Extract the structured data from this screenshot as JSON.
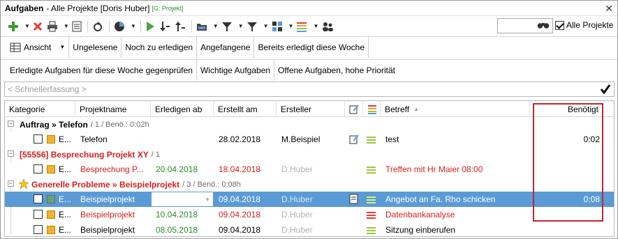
{
  "window": {
    "title": "Aufgaben",
    "subtitle": "- Alle Projekte [Doris Huber]",
    "tag": "[G: Projekt]",
    "close_glyph": "✕"
  },
  "toolbar": {
    "icons": [
      "add-icon",
      "delete-icon",
      "print-icon",
      "report-icon",
      "refresh-icon",
      "chart-icon",
      "play-icon",
      "sort-down-icon",
      "sort-up-icon",
      "folder-icon",
      "filter-icon",
      "filter2-icon",
      "categories-icon",
      "priority-icon",
      "users-icon"
    ],
    "all_projects_label": "Alle Projekte",
    "all_projects_checked": true,
    "search_icon": "binoculars-icon"
  },
  "filters_row1": [
    "Ansicht",
    "Ungelesene",
    "Noch zu erledigen",
    "Angefangene",
    "Bereits erledigt diese Woche"
  ],
  "filters_row2": [
    "Erledigte Aufgaben für diese Woche gegenprüfen",
    "Wichtige Aufgaben",
    "Offene Aufgaben, hohe Priorität"
  ],
  "quick_entry": {
    "placeholder": "< Schnellerfassung >"
  },
  "columns": {
    "kategorie": "Kategorie",
    "projektname": "Projektname",
    "erledigen_ab": "Erledigen ab",
    "erstellt_am": "Erstellt am",
    "ersteller": "Ersteller",
    "betreff": "Betreff",
    "benoetigt": "Benötigt"
  },
  "groups": [
    {
      "title": "Auftrag » Telefon",
      "meta": "/ 1 / Benö.: 0:02h",
      "color": "#1a1a8c",
      "rows": [
        {
          "kat": "E...",
          "projekt": "Telefon",
          "erledigen": "",
          "erstellt": "28.02.2018",
          "ersteller": "M.Beispiel",
          "betreff": "test",
          "benoetigt": "0:02"
        }
      ]
    },
    {
      "title": "[55556] Besprechung Projekt XY",
      "meta": "/ 1",
      "color": "#d42020",
      "rows": [
        {
          "kat": "E...",
          "projekt": "Besprechung P...",
          "erledigen": "20.04.2018",
          "erstellt": "18.04.2018",
          "ersteller": "D.Huber",
          "betreff": "Treffen mit Hr Maier 08:00",
          "benoetigt": ""
        }
      ]
    },
    {
      "title": "Generelle Probleme » Beispielprojekt",
      "meta": "/ 3 / Benö.: 0:08h",
      "color": "#d42020",
      "rows": [
        {
          "kat": "E...",
          "projekt": "Beispielprojekt",
          "erledigen": "",
          "erstellt": "09.04.2018",
          "ersteller": "D.Huber",
          "betreff": "Angebot an Fa. Rho schicken",
          "benoetigt": "0:08"
        },
        {
          "kat": "E...",
          "projekt": "Beispielprojekt",
          "erledigen": "10.04.2018",
          "erstellt": "09.04.2018",
          "ersteller": "D.Huber",
          "betreff": "Datenbankanalyse",
          "benoetigt": ""
        },
        {
          "kat": "E...",
          "projekt": "Beispielprojekt",
          "erledigen": "08.05.2018",
          "erstellt": "09.04.2018",
          "ersteller": "D.Huber",
          "betreff": "Sitzung einberufen",
          "benoetigt": ""
        }
      ]
    }
  ],
  "colors": {
    "selection": "#5b9bd5",
    "accent_red": "#d42020",
    "accent_green": "#2e8b2e",
    "group_blue": "#1a1a8c",
    "highlight_box": "#c0262c"
  }
}
